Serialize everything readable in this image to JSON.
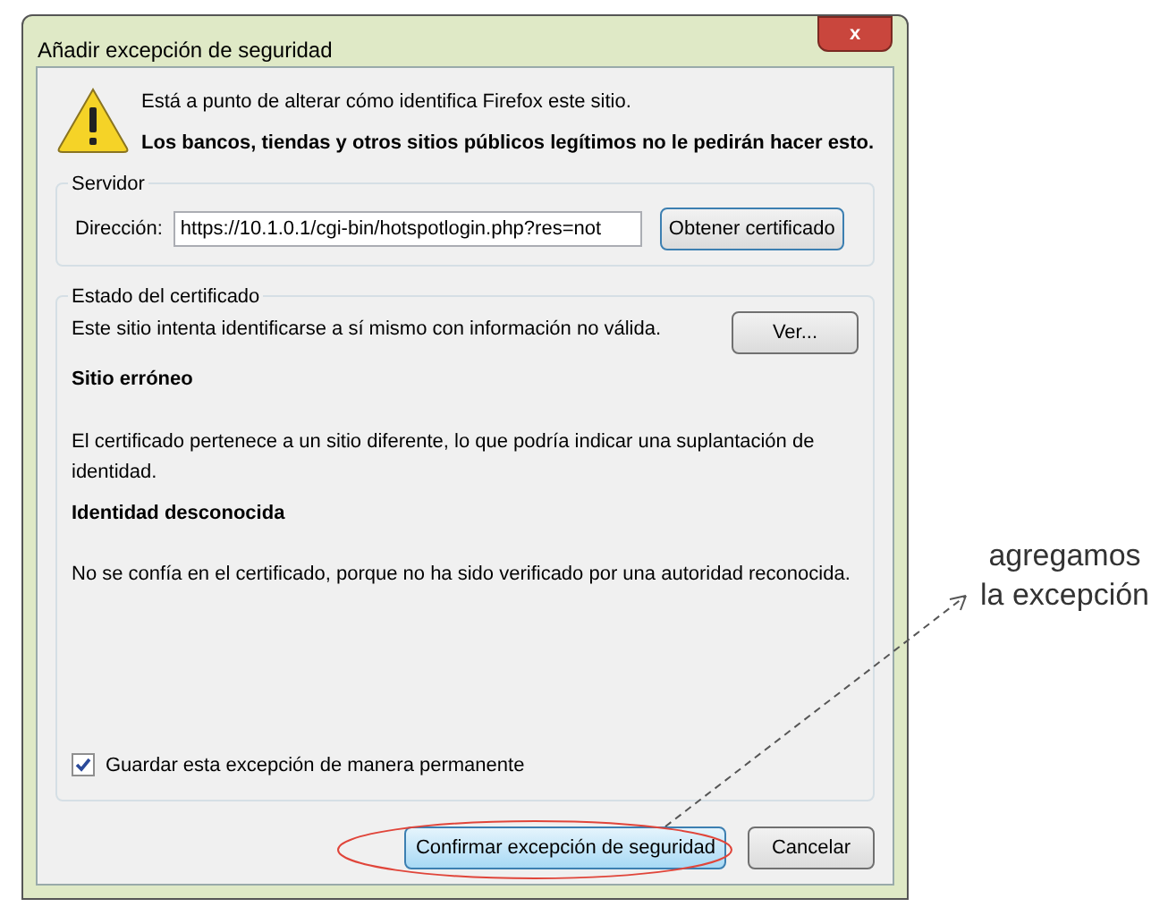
{
  "window": {
    "title": "Añadir excepción de seguridad",
    "close": "x"
  },
  "warning": {
    "line_1": "Está a punto de alterar cómo identifica Firefox este sitio.",
    "line_2": "Los bancos, tiendas y otros sitios públicos legítimos no le pedirán hacer esto."
  },
  "server": {
    "legend": "Servidor",
    "label": "Dirección:",
    "value": "https://10.1.0.1/cgi-bin/hotspotlogin.php?res=not",
    "button": "Obtener certificado"
  },
  "certificate_status": {
    "legend": "Estado del certificado",
    "intro": "Este sitio intenta identificarse a sí mismo con información no válida.",
    "button": "Ver...",
    "sections": [
      {
        "heading": "Sitio erróneo",
        "body": "El certificado pertenece a un sitio diferente, lo que podría indicar una suplantación de identidad."
      },
      {
        "heading": "Identidad desconocida",
        "body": "No se confía en el certificado, porque no ha sido verificado por una autoridad reconocida."
      }
    ]
  },
  "permanent": {
    "label": "Guardar esta excepción de manera permanente",
    "checked": true
  },
  "buttons": [
    {
      "label": "Confirmar excepción de seguridad",
      "default": true
    },
    {
      "label": "Cancelar",
      "default": false
    }
  ],
  "annotation": {
    "line_1": "agregamos",
    "line_2": "la excepción"
  }
}
